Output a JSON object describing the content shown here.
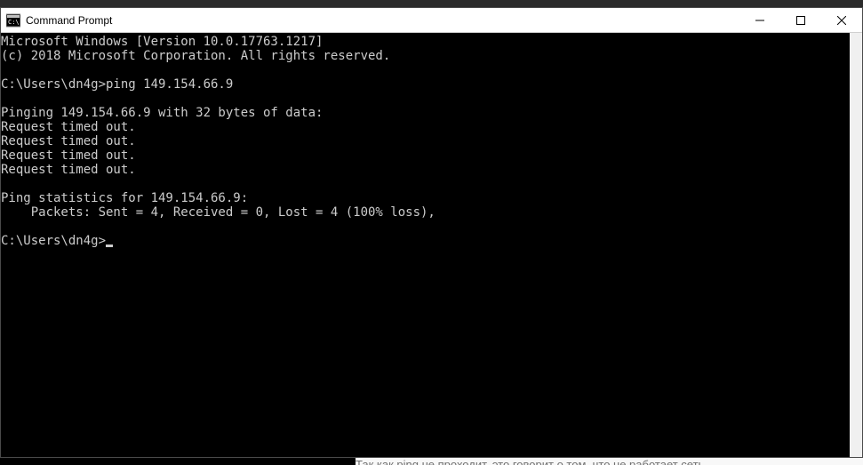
{
  "window": {
    "title": "Command Prompt"
  },
  "terminal": {
    "lines": [
      "Microsoft Windows [Version 10.0.17763.1217]",
      "(c) 2018 Microsoft Corporation. All rights reserved.",
      "",
      "C:\\Users\\dn4g>ping 149.154.66.9",
      "",
      "Pinging 149.154.66.9 with 32 bytes of data:",
      "Request timed out.",
      "Request timed out.",
      "Request timed out.",
      "Request timed out.",
      "",
      "Ping statistics for 149.154.66.9:",
      "    Packets: Sent = 4, Received = 0, Lost = 4 (100% loss),",
      "",
      "C:\\Users\\dn4g>"
    ],
    "cursor_after_last": true
  },
  "background": {
    "partial_text": "Так как ping не проходит, это говорит о том, что не работает сеть"
  }
}
